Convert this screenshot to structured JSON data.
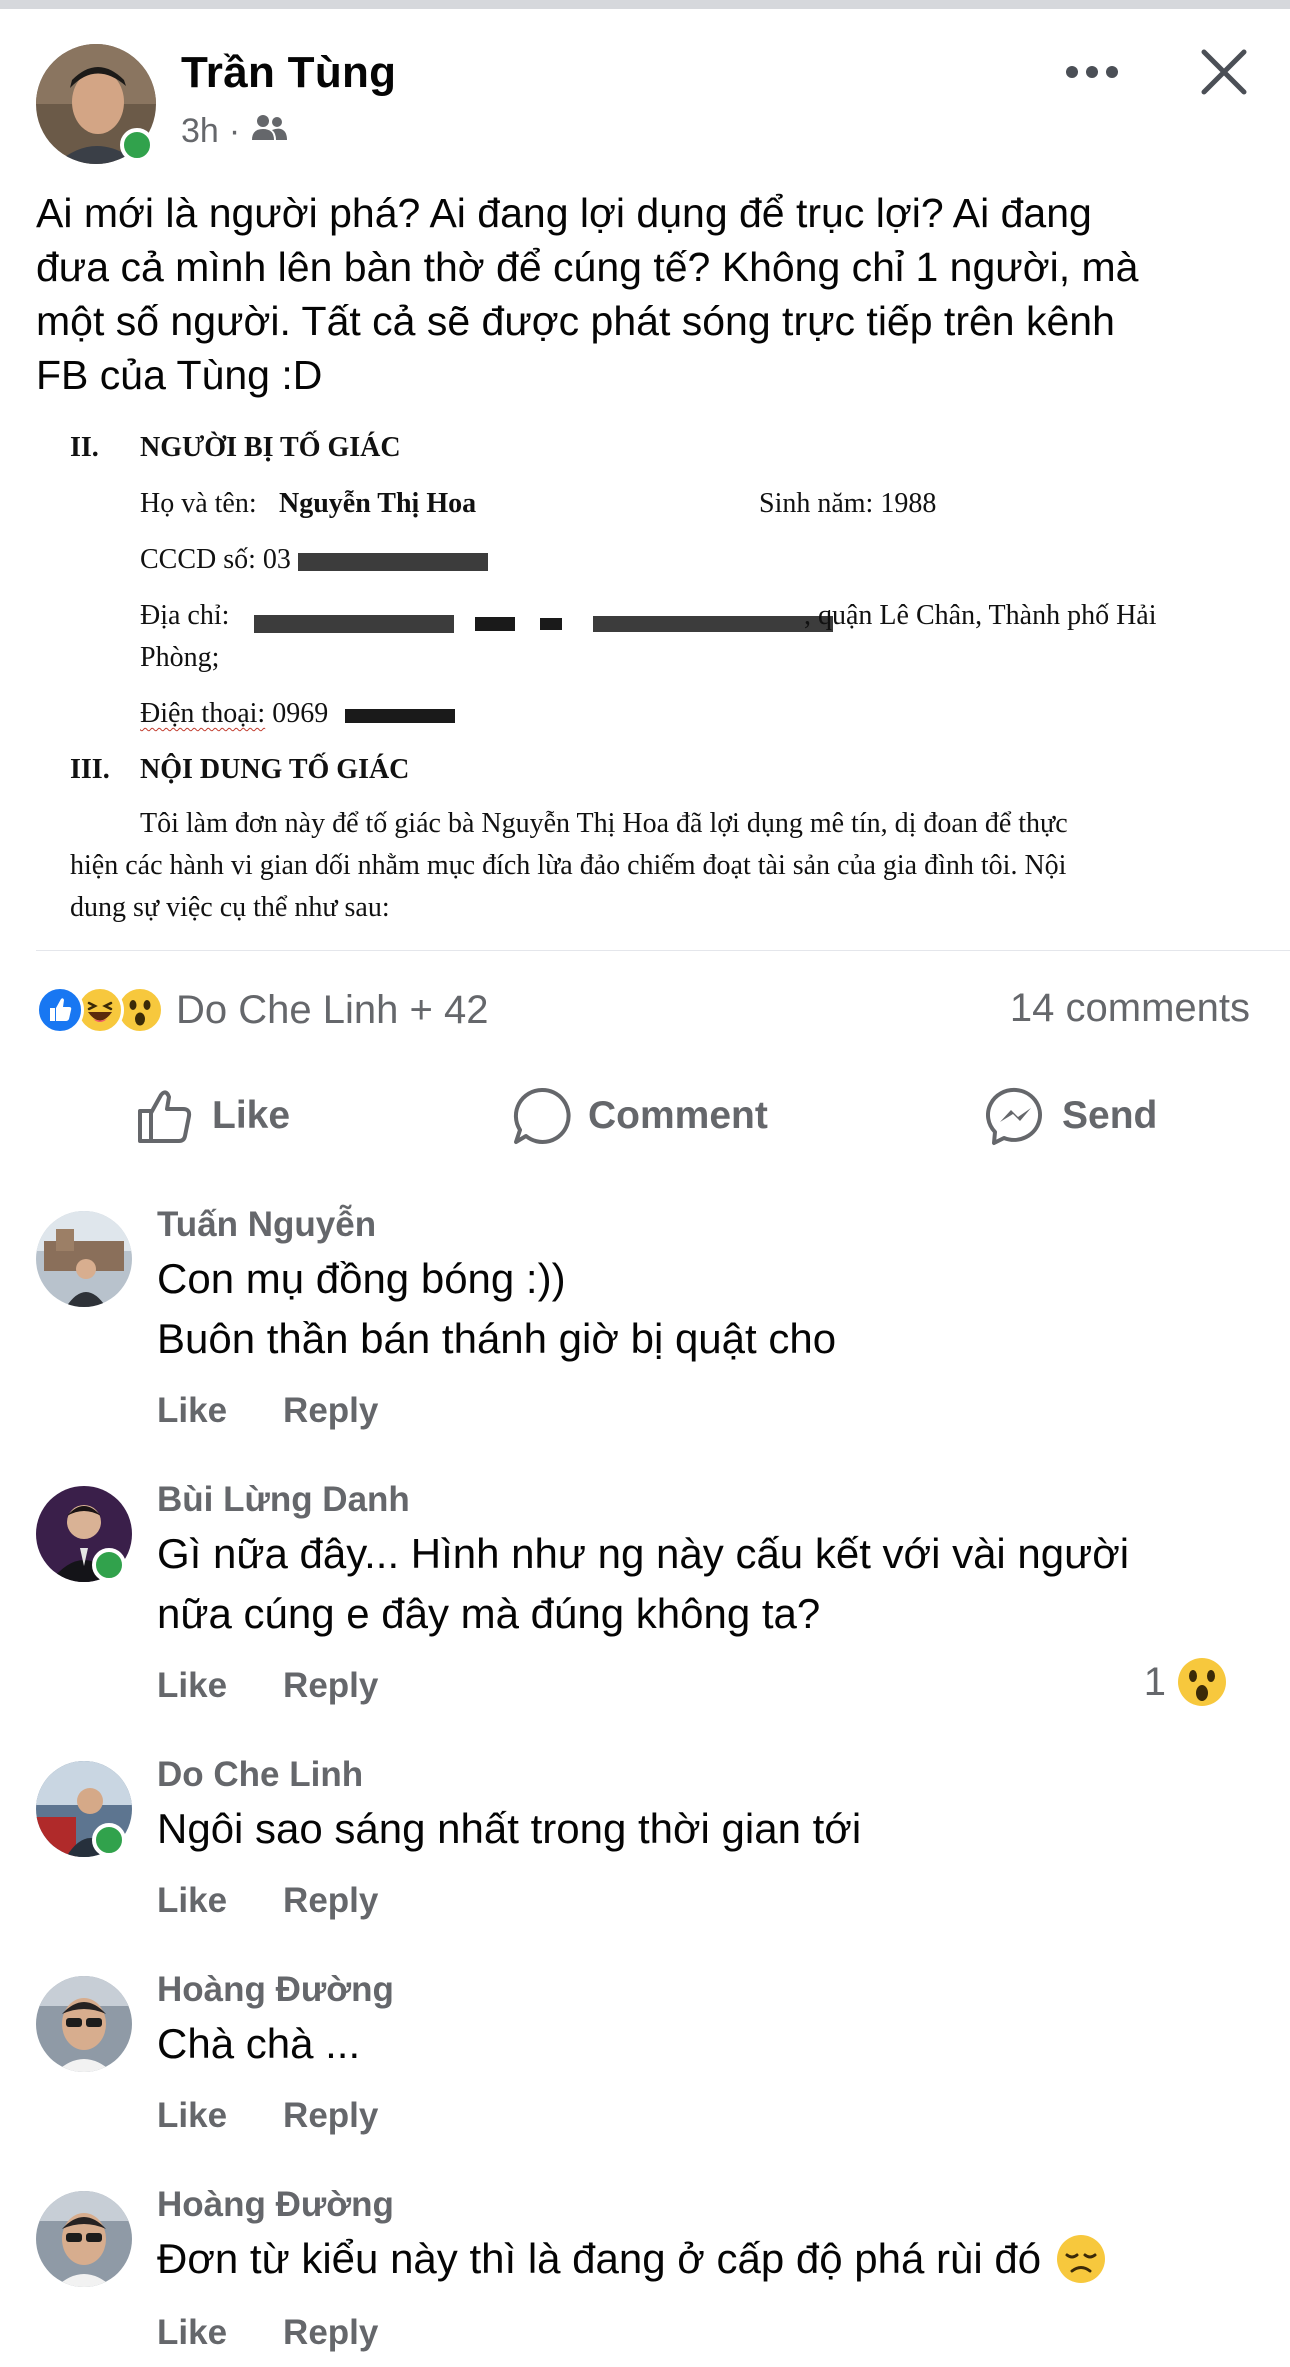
{
  "post": {
    "author": "Trần Tùng",
    "time": "3h",
    "visibility_icon": "friends-icon",
    "text": "Ai mới là người phá? Ai đang lợi dụng để trục lợi? Ai đang\nđưa cả mình lên bàn thờ để cúng tế? Không chỉ 1 người, mà\nmột số người.  Tất cả sẽ được phát sóng trực tiếp trên kênh\nFB của Tùng :D"
  },
  "document": {
    "section2_num": "II.",
    "section2_title": "NGƯỜI BỊ TỐ GIÁC",
    "name_label": "Họ và tên:",
    "name_value": "Nguyễn Thị Hoa",
    "birth": "Sinh năm: 1988",
    "id_label": "CCCD số: 03",
    "address_label": "Địa chỉ:",
    "address_tail": ", quận Lê Chân, Thành phố Hải",
    "address_line2": "Phòng;",
    "phone_label": "Điện thoại:",
    "phone_value": "0969",
    "section3_num": "III.",
    "section3_title": "NỘI DUNG TỐ GIÁC",
    "para_line1": "Tôi làm đơn này để tố giác bà Nguyễn Thị Hoa đã lợi dụng mê tín, dị đoan để thực",
    "para_line2": "hiện các hành vi gian dối nhằm mục đích lừa đảo chiếm đoạt tài sản của gia đình tôi. Nội",
    "para_line3": "dung sự việc cụ thể như sau:"
  },
  "reactions": {
    "names": "Do Che Linh + 42",
    "comments_count": "14 comments",
    "icons": [
      "like-reaction-icon",
      "haha-reaction-icon",
      "wow-reaction-icon"
    ]
  },
  "actions": {
    "like": "Like",
    "comment": "Comment",
    "send": "Send"
  },
  "comments": [
    {
      "name": "Tuấn Nguyễn",
      "text": "Con mụ đồng bóng :))\nBuôn thần bán thánh giờ bị quật cho",
      "like": "Like",
      "reply": "Reply"
    },
    {
      "name": "Bùi Lừng Danh",
      "text": "Gì nữa đây... Hình như ng này cấu kết với vài người\nnữa cúng e đây mà đúng không ta?",
      "like": "Like",
      "reply": "Reply",
      "reaction_count": "1"
    },
    {
      "name": "Do Che Linh",
      "text": "Ngôi sao sáng nhất trong thời gian tới",
      "like": "Like",
      "reply": "Reply"
    },
    {
      "name": "Hoàng Đường",
      "text": "Chà chà ...",
      "like": "Like",
      "reply": "Reply"
    },
    {
      "name": "Hoàng Đường",
      "text": "Đơn từ kiểu này thì là đang ở cấp độ phá rùi đó",
      "like": "Like",
      "reply": "Reply"
    }
  ],
  "colors": {
    "text": "#050505",
    "secondary": "#65676b",
    "online": "#31a24c",
    "like_blue": "#1877f2"
  }
}
